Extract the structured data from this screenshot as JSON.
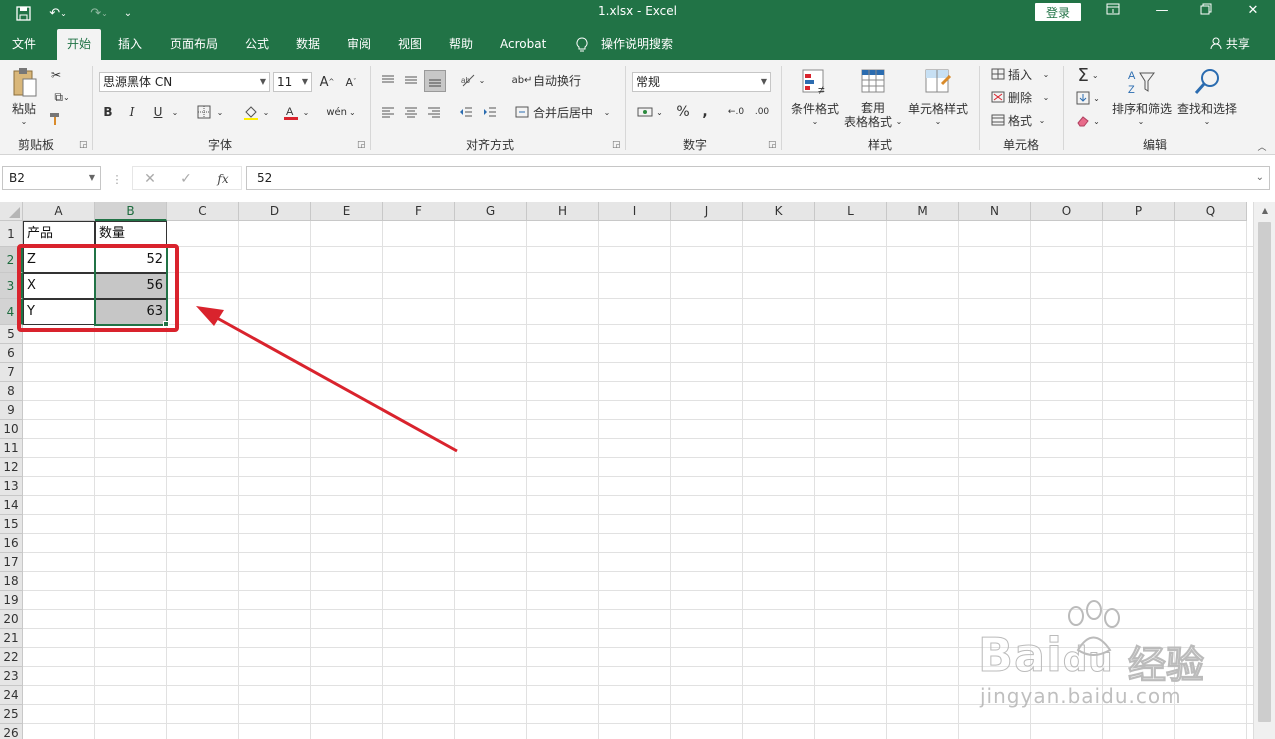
{
  "title": "1.xlsx  -  Excel",
  "login": "登录",
  "tabs": [
    "文件",
    "开始",
    "插入",
    "页面布局",
    "公式",
    "数据",
    "审阅",
    "视图",
    "帮助",
    "Acrobat",
    "操作说明搜索"
  ],
  "share": "共享",
  "ribbon": {
    "clipboard": {
      "paste": "粘贴",
      "label": "剪贴板"
    },
    "font": {
      "name": "思源黑体 CN",
      "size": "11",
      "label": "字体",
      "bold": "B",
      "italic": "I",
      "underline": "U"
    },
    "align": {
      "wrap": "自动换行",
      "merge": "合并后居中",
      "label": "对齐方式"
    },
    "number": {
      "format": "常规",
      "label": "数字",
      "percent": "%",
      "comma": ","
    },
    "styles": {
      "cond": "条件格式",
      "table1": "套用",
      "table2": "表格格式",
      "cell": "单元格样式",
      "label": "样式"
    },
    "cells": {
      "insert": "插入",
      "delete": "删除",
      "format": "格式",
      "label": "单元格"
    },
    "edit": {
      "sort": "排序和筛选",
      "find": "查找和选择",
      "label": "编辑"
    }
  },
  "namebox": "B2",
  "formula": "52",
  "columns": [
    "A",
    "B",
    "C",
    "D",
    "E",
    "F",
    "G",
    "H",
    "I",
    "J",
    "K",
    "L",
    "M",
    "N",
    "O",
    "P",
    "Q"
  ],
  "rows": [
    "1",
    "2",
    "3",
    "4",
    "5",
    "6",
    "7",
    "8",
    "9",
    "10",
    "11",
    "12",
    "13",
    "14",
    "15",
    "16",
    "17",
    "18",
    "19",
    "20",
    "21",
    "22",
    "23",
    "24",
    "25",
    "26"
  ],
  "cells": {
    "A1": "产品",
    "B1": "数量",
    "A2": "Z",
    "B2": "52",
    "A3": "X",
    "B3": "56",
    "A4": "Y",
    "B4": "63"
  },
  "selection": "B2:B4",
  "annotation_color": "#d9232d",
  "accent": "#217346",
  "watermark": {
    "brand": "Bai",
    "brand2": "du",
    "cn": "经验",
    "url": "jingyan.baidu.com"
  }
}
